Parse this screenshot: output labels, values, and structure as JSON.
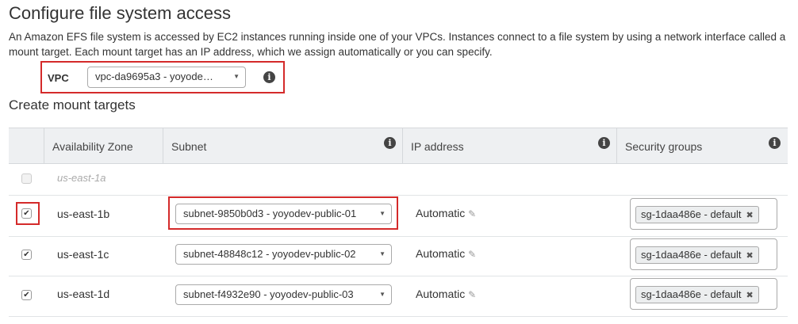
{
  "title": "Configure file system access",
  "description": "An Amazon EFS file system is accessed by EC2 instances running inside one of your VPCs. Instances connect to a file system by using a network interface called a mount target. Each mount target has an IP address, which we assign automatically or you can specify.",
  "vpc": {
    "label": "VPC",
    "value": "vpc-da9695a3 - yoyode…"
  },
  "section_title": "Create mount targets",
  "table": {
    "headers": {
      "availability_zone": "Availability Zone",
      "subnet": "Subnet",
      "ip_address": "IP address",
      "security_groups": "Security groups"
    },
    "rows": [
      {
        "checked": false,
        "disabled": true,
        "zone": "us-east-1a"
      },
      {
        "checked": true,
        "zone": "us-east-1b",
        "subnet": "subnet-9850b0d3 - yoyodev-public-01",
        "ip": "Automatic",
        "sg": "sg-1daa486e - default"
      },
      {
        "checked": true,
        "zone": "us-east-1c",
        "subnet": "subnet-48848c12 - yoyodev-public-02",
        "ip": "Automatic",
        "sg": "sg-1daa486e - default"
      },
      {
        "checked": true,
        "zone": "us-east-1d",
        "subnet": "subnet-f4932e90 - yoyodev-public-03",
        "ip": "Automatic",
        "sg": "sg-1daa486e - default"
      }
    ]
  },
  "icons": {
    "info": "info-icon",
    "pencil": "pencil-icon",
    "remove": "remove-tag-icon",
    "caret": "caret-down-icon",
    "check": "checkmark-icon"
  },
  "colors": {
    "highlight": "#d42a2a",
    "header_bg": "#eef0f2"
  }
}
